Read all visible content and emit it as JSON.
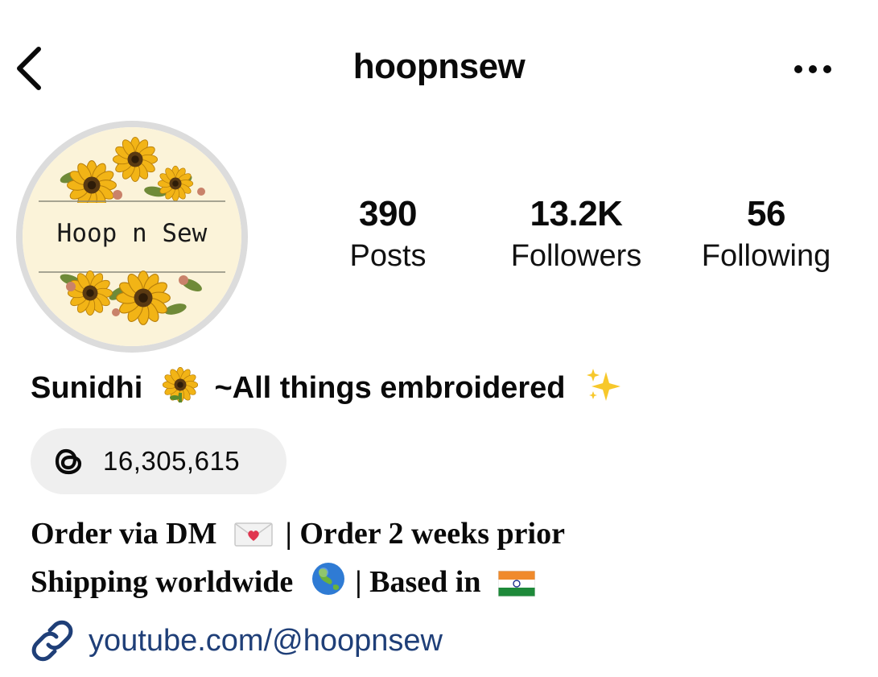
{
  "header": {
    "username": "hoopnsew",
    "back_icon": "chevron-left-icon",
    "more_icon": "ellipsis-horizontal-icon"
  },
  "avatar": {
    "logo_text": "Hoop n Sew",
    "colors": {
      "background": "#fbf3d9",
      "petal": "#f2b416",
      "center": "#5a3a12",
      "leaf": "#6f8a38"
    }
  },
  "stats": {
    "posts": {
      "count": "390",
      "label": "Posts"
    },
    "followers": {
      "count": "13.2K",
      "label": "Followers"
    },
    "following": {
      "count": "56",
      "label": "Following"
    }
  },
  "profile": {
    "name": "Sunidhi",
    "tagline": "~All things embroidered",
    "name_emoji": "sunflower",
    "tagline_emoji": "sparkles"
  },
  "threads": {
    "icon": "threads-icon",
    "count": "16,305,615"
  },
  "bio": {
    "line1_a": "Order via DM",
    "line1_b": "| Order 2 weeks prior",
    "line2_a": "Shipping worldwide",
    "line2_b": "| Based in",
    "emojis": [
      "love-letter",
      "globe-asia-australia",
      "flag-india"
    ]
  },
  "link": {
    "icon": "link-icon",
    "text": "youtube.com/@hoopnsew",
    "color": "#1f3f78"
  }
}
